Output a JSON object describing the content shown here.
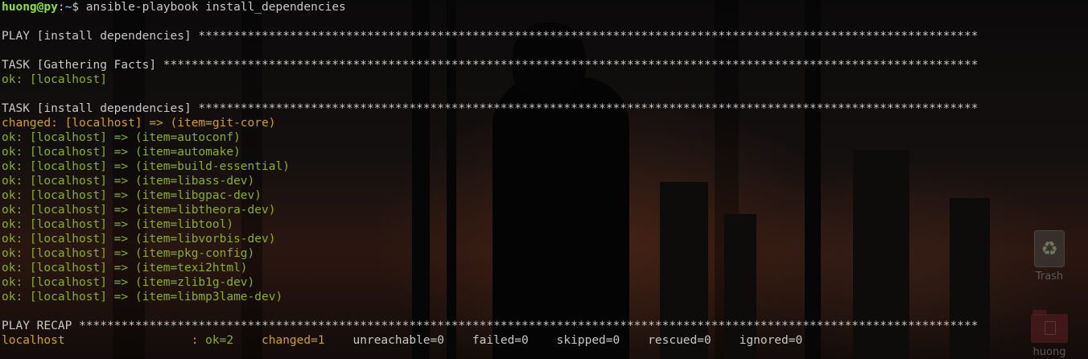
{
  "prompt": {
    "user_host": "huong@py",
    "separator": ":",
    "path": "~",
    "symbol": "$ ",
    "command": "ansible-playbook install_dependencies"
  },
  "play": {
    "header": "PLAY [install dependencies] ***************************************************************************************************************"
  },
  "task_facts": {
    "header": "TASK [Gathering Facts] ********************************************************************************************************************",
    "result": "ok: [localhost]"
  },
  "task_install": {
    "header": "TASK [install dependencies] ***************************************************************************************************************",
    "results": [
      {
        "status": "changed",
        "text": "changed: [localhost] => (item=git-core)"
      },
      {
        "status": "ok",
        "text": "ok: [localhost] => (item=autoconf)"
      },
      {
        "status": "ok",
        "text": "ok: [localhost] => (item=automake)"
      },
      {
        "status": "ok",
        "text": "ok: [localhost] => (item=build-essential)"
      },
      {
        "status": "ok",
        "text": "ok: [localhost] => (item=libass-dev)"
      },
      {
        "status": "ok",
        "text": "ok: [localhost] => (item=libgpac-dev)"
      },
      {
        "status": "ok",
        "text": "ok: [localhost] => (item=libtheora-dev)"
      },
      {
        "status": "ok",
        "text": "ok: [localhost] => (item=libtool)"
      },
      {
        "status": "ok",
        "text": "ok: [localhost] => (item=libvorbis-dev)"
      },
      {
        "status": "ok",
        "text": "ok: [localhost] => (item=pkg-config)"
      },
      {
        "status": "ok",
        "text": "ok: [localhost] => (item=texi2html)"
      },
      {
        "status": "ok",
        "text": "ok: [localhost] => (item=zlib1g-dev)"
      },
      {
        "status": "ok",
        "text": "ok: [localhost] => (item=libmp3lame-dev)"
      }
    ]
  },
  "recap": {
    "header": "PLAY RECAP ********************************************************************************************************************************",
    "host": "localhost                  : ",
    "ok": "ok=2   ",
    "changed": " changed=1   ",
    "rest": " unreachable=0    failed=0    skipped=0    rescued=0    ignored=0"
  },
  "desktop": {
    "trash_label": "Trash",
    "folder_label": "huong"
  },
  "colors": {
    "ok": "#8ab01c",
    "changed": "#d4a017",
    "prompt_user": "#8ae234",
    "prompt_path": "#729fcf",
    "text": "#c8c8c8"
  }
}
